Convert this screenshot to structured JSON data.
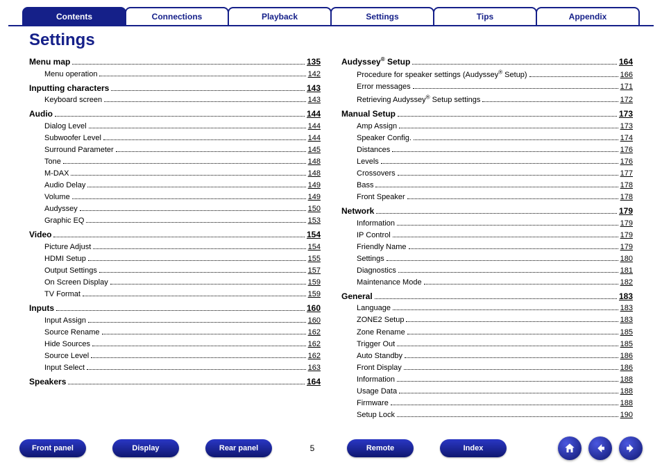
{
  "tabs": [
    {
      "label": "Contents",
      "active": true
    },
    {
      "label": "Connections",
      "active": false
    },
    {
      "label": "Playback",
      "active": false
    },
    {
      "label": "Settings",
      "active": false
    },
    {
      "label": "Tips",
      "active": false
    },
    {
      "label": "Appendix",
      "active": false
    }
  ],
  "title": "Settings",
  "page_number": "5",
  "bottom_buttons": {
    "front_panel": "Front panel",
    "display": "Display",
    "rear_panel": "Rear panel",
    "remote": "Remote",
    "index": "Index"
  },
  "columns": [
    [
      {
        "level": 0,
        "label": "Menu map",
        "page": "135"
      },
      {
        "level": 1,
        "label": "Menu operation",
        "page": "142"
      },
      {
        "level": 0,
        "label": "Inputting characters",
        "page": "143"
      },
      {
        "level": 1,
        "label": "Keyboard screen",
        "page": "143"
      },
      {
        "level": 0,
        "label": "Audio",
        "page": "144"
      },
      {
        "level": 1,
        "label": "Dialog Level",
        "page": "144"
      },
      {
        "level": 1,
        "label": "Subwoofer Level",
        "page": "144"
      },
      {
        "level": 1,
        "label": "Surround Parameter",
        "page": "145"
      },
      {
        "level": 1,
        "label": "Tone",
        "page": "148"
      },
      {
        "level": 1,
        "label": "M-DAX",
        "page": "148"
      },
      {
        "level": 1,
        "label": "Audio Delay",
        "page": "149"
      },
      {
        "level": 1,
        "label": "Volume",
        "page": "149"
      },
      {
        "level": 1,
        "label": "Audyssey",
        "page": "150"
      },
      {
        "level": 1,
        "label": "Graphic EQ",
        "page": "153"
      },
      {
        "level": 0,
        "label": "Video",
        "page": "154"
      },
      {
        "level": 1,
        "label": "Picture Adjust",
        "page": "154"
      },
      {
        "level": 1,
        "label": "HDMI Setup",
        "page": "155"
      },
      {
        "level": 1,
        "label": "Output Settings",
        "page": "157"
      },
      {
        "level": 1,
        "label": "On Screen Display",
        "page": "159"
      },
      {
        "level": 1,
        "label": "TV Format",
        "page": "159"
      },
      {
        "level": 0,
        "label": "Inputs",
        "page": "160"
      },
      {
        "level": 1,
        "label": "Input Assign",
        "page": "160"
      },
      {
        "level": 1,
        "label": "Source Rename",
        "page": "162"
      },
      {
        "level": 1,
        "label": "Hide Sources",
        "page": "162"
      },
      {
        "level": 1,
        "label": "Source Level",
        "page": "162"
      },
      {
        "level": 1,
        "label": "Input Select",
        "page": "163"
      },
      {
        "level": 0,
        "label": "Speakers",
        "page": "164"
      }
    ],
    [
      {
        "level": 0,
        "label": "Audyssey® Setup",
        "reg": true,
        "page": "164"
      },
      {
        "level": 1,
        "label": "Procedure for speaker settings (Audyssey® Setup)",
        "reg": true,
        "page": "166"
      },
      {
        "level": 1,
        "label": "Error messages",
        "page": "171"
      },
      {
        "level": 1,
        "label": "Retrieving Audyssey® Setup settings",
        "reg": true,
        "page": "172"
      },
      {
        "level": 0,
        "label": "Manual Setup",
        "page": "173"
      },
      {
        "level": 1,
        "label": "Amp Assign",
        "page": "173"
      },
      {
        "level": 1,
        "label": "Speaker Config.",
        "page": "174"
      },
      {
        "level": 1,
        "label": "Distances",
        "page": "176"
      },
      {
        "level": 1,
        "label": "Levels",
        "page": "176"
      },
      {
        "level": 1,
        "label": "Crossovers",
        "page": "177"
      },
      {
        "level": 1,
        "label": "Bass",
        "page": "178"
      },
      {
        "level": 1,
        "label": "Front Speaker",
        "page": "178"
      },
      {
        "level": 0,
        "label": "Network",
        "page": "179"
      },
      {
        "level": 1,
        "label": "Information",
        "page": "179"
      },
      {
        "level": 1,
        "label": "IP Control",
        "page": "179"
      },
      {
        "level": 1,
        "label": "Friendly Name",
        "page": "179"
      },
      {
        "level": 1,
        "label": "Settings",
        "page": "180"
      },
      {
        "level": 1,
        "label": "Diagnostics",
        "page": "181"
      },
      {
        "level": 1,
        "label": "Maintenance Mode",
        "page": "182"
      },
      {
        "level": 0,
        "label": "General",
        "page": "183"
      },
      {
        "level": 1,
        "label": "Language",
        "page": "183"
      },
      {
        "level": 1,
        "label": "ZONE2 Setup",
        "page": "183"
      },
      {
        "level": 1,
        "label": "Zone Rename",
        "page": "185"
      },
      {
        "level": 1,
        "label": "Trigger Out",
        "page": "185"
      },
      {
        "level": 1,
        "label": "Auto Standby",
        "page": "186"
      },
      {
        "level": 1,
        "label": "Front Display",
        "page": "186"
      },
      {
        "level": 1,
        "label": "Information",
        "page": "188"
      },
      {
        "level": 1,
        "label": "Usage Data",
        "page": "188"
      },
      {
        "level": 1,
        "label": "Firmware",
        "page": "188"
      },
      {
        "level": 1,
        "label": "Setup Lock",
        "page": "190"
      }
    ]
  ]
}
